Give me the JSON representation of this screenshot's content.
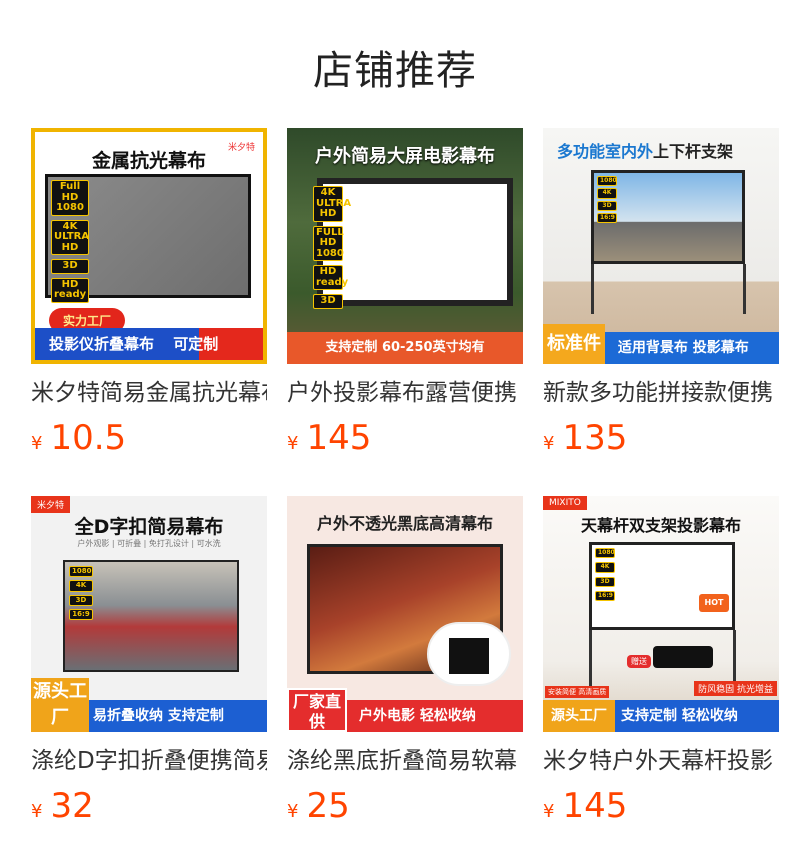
{
  "section_title": "店铺推荐",
  "currency": "¥",
  "products": [
    {
      "name": "米夕特简易金属抗光幕布",
      "price": "10.5",
      "image": {
        "headline": "金属抗光幕布",
        "brand": "米夕特",
        "badges": [
          "Full HD 1080",
          "4K ULTRA HD",
          "3D",
          "HD ready"
        ],
        "pill": "实力工厂",
        "banner_left": "投影仪折叠幕布",
        "banner_right": "可定制"
      }
    },
    {
      "name": "户外投影幕布露营便携",
      "price": "145",
      "image": {
        "headline": "户外简易大屏电影幕布",
        "badges": [
          "4K ULTRA HD",
          "FULL HD 1080",
          "HD ready",
          "3D"
        ],
        "banner": "支持定制 60-250英寸均有"
      }
    },
    {
      "name": "新款多功能拼接款便携",
      "price": "135",
      "image": {
        "headline_blue": "多功能室内外",
        "headline_dark": "上下杆支架",
        "badges": [
          "1080",
          "4K",
          "3D",
          "16:9"
        ],
        "label": "标准件",
        "banner": "适用背景布 投影幕布"
      }
    },
    {
      "name": "涤纶D字扣折叠便携简易",
      "price": "32",
      "image": {
        "corner": "米夕特",
        "headline": "全D字扣简易幕布",
        "sub": "户外观影 | 可折叠 | 免打孔设计 | 可水洗",
        "badges": [
          "1080",
          "4K",
          "3D",
          "16:9"
        ],
        "source_label": "源头工厂",
        "banner": "易折叠收纳 支持定制"
      }
    },
    {
      "name": "涤纶黑底折叠简易软幕",
      "price": "25",
      "image": {
        "headline": "户外不透光黑底高清幕布",
        "source_label": "厂家直供",
        "banner": "户外电影 轻松收纳"
      }
    },
    {
      "name": "米夕特户外天幕杆投影",
      "price": "145",
      "image": {
        "corner": "MIXITO",
        "headline": "天幕杆双支架投影幕布",
        "badges": [
          "1080",
          "4K",
          "3D",
          "16:9"
        ],
        "hot": "HOT",
        "gift": "赠送",
        "tag_left": "安装简便 高清画质",
        "tag_right": "防风稳固 抗光增益",
        "source_label": "源头工厂",
        "banner": "支持定制 轻松收纳"
      }
    }
  ]
}
